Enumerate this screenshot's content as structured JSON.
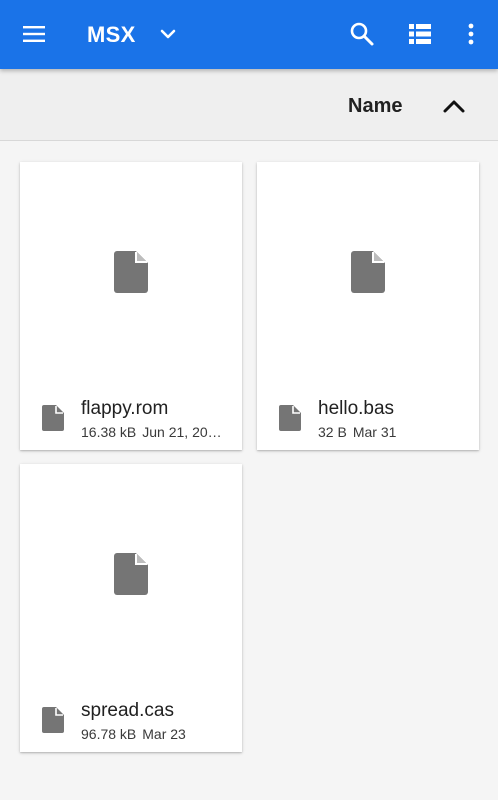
{
  "appbar": {
    "title": "MSX",
    "icons": [
      "menu-icon",
      "chevron-down-icon",
      "search-icon",
      "view-list-icon",
      "more-vert-icon"
    ],
    "color": "#1a73e8"
  },
  "sort": {
    "label": "Name",
    "direction_icon": "chevron-up-icon"
  },
  "files": [
    {
      "name": "flappy.rom",
      "size": "16.38 kB",
      "date": "Jun 21, 20…"
    },
    {
      "name": "hello.bas",
      "size": "32 B",
      "date": "Mar 31"
    },
    {
      "name": "spread.cas",
      "size": "96.78 kB",
      "date": "Mar 23"
    }
  ]
}
